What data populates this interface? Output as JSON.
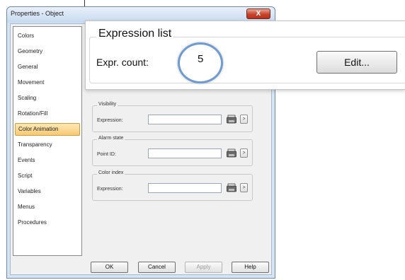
{
  "window": {
    "title": "Properties - Object",
    "close_label": "X"
  },
  "nav": {
    "items": [
      {
        "label": "Colors"
      },
      {
        "label": "Geometry"
      },
      {
        "label": "General"
      },
      {
        "label": "Movement"
      },
      {
        "label": "Scaling"
      },
      {
        "label": "Rotation/Fill"
      },
      {
        "label": "Color Animation",
        "selected": true
      },
      {
        "label": "Transparency"
      },
      {
        "label": "Events"
      },
      {
        "label": "Script"
      },
      {
        "label": "Variables"
      },
      {
        "label": "Menus"
      },
      {
        "label": "Procedures"
      }
    ]
  },
  "groups": {
    "visibility": {
      "title": "Visibility",
      "label": "Expression:"
    },
    "alarm": {
      "title": "Alarm state",
      "label": "Point ID:"
    },
    "color_index": {
      "title": "Color index",
      "label": "Expression:"
    }
  },
  "buttons": {
    "ok": "OK",
    "cancel": "Cancel",
    "apply": "Apply",
    "help": "Help",
    "arrow": ">"
  },
  "callout": {
    "title": "Expression list",
    "count_label": "Expr. count:",
    "count_value": "5",
    "edit_label": "Edit..."
  },
  "colors": {
    "selection": "#f7c974",
    "accent_ring": "#6f9bd1",
    "close_red": "#c7442c"
  }
}
